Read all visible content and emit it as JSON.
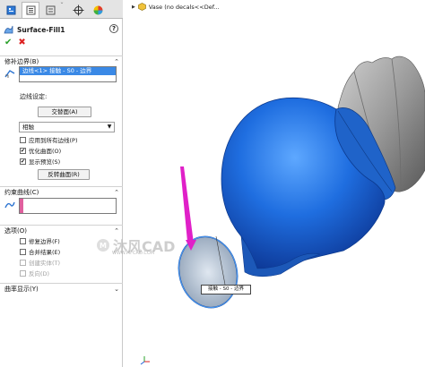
{
  "panel": {
    "feature_title": "Surface-Fill1",
    "help_label": "?",
    "sections": {
      "patch_boundary": {
        "title": "修补边界(B)",
        "selected_item": "边线<1> 接触 - S0 - 边界",
        "edge_settings_label": "边线设定:",
        "alternate_face_button": "交替面(A)",
        "contact_select_value": "相触",
        "apply_all_edges": "应用到所有边线(P)",
        "optimize_surface": "优化曲面(O)",
        "show_preview": "显示预览(S)",
        "reverse_surface_button": "反转曲面(R)"
      },
      "constraint_curves": {
        "title": "约束曲线(C)"
      },
      "options": {
        "title": "选项(O)",
        "fix_boundary": "修复边界(F)",
        "merge_result": "合并结果(E)",
        "create_solid": "创建实体(T)",
        "reverse": "反向(D)"
      },
      "curvature_display": {
        "title": "曲率显示(Y)"
      }
    }
  },
  "viewport": {
    "tree_node": "Vase  (no decals<<Def...",
    "callout": "接触 - S0 - 边界",
    "watermark_text": "沐风CAD",
    "watermark_sub": "WWW.MFCAD.COM"
  },
  "colors": {
    "selection_blue": "#3a89e6",
    "vase_blue": "#1f63c9",
    "neck_gray": "#9a9a9a",
    "arrow_magenta": "#e020c8",
    "constraint_pink": "#e0609e"
  },
  "icons": {
    "tabs": [
      "feature-manager-icon",
      "property-manager-icon",
      "configuration-manager-icon",
      "dimxpert-icon",
      "display-manager-icon"
    ]
  }
}
